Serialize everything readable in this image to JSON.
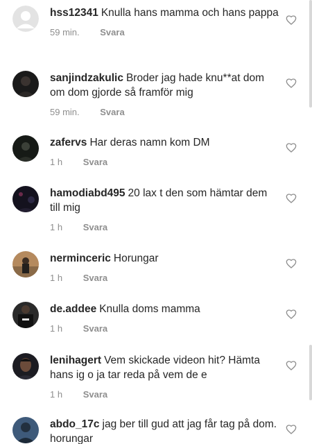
{
  "comments": [
    {
      "username": "hss12341",
      "text": "Knulla hans mamma och hans pappa",
      "time": "59 min.",
      "reply": "Svara",
      "avatar": "default-avatar"
    },
    {
      "username": "sanjindzakulic",
      "text": "Broder jag hade knu**at dom om dom gjorde så framför mig",
      "time": "59 min.",
      "reply": "Svara",
      "avatar": "dark-photo"
    },
    {
      "username": "zafervs",
      "text": "Har deras namn kom DM",
      "time": "1 h",
      "reply": "Svara",
      "avatar": "dark-photo"
    },
    {
      "username": "hamodiabd495",
      "text": "20 lax t den som hämtar dem till mig",
      "time": "1 h",
      "reply": "Svara",
      "avatar": "night-photo"
    },
    {
      "username": "nermin​ceric",
      "text": "Horungar",
      "time": "1 h",
      "reply": "Svara",
      "avatar": "outdoor-photo"
    },
    {
      "username": "de.addee",
      "text": "Knulla doms mamma",
      "time": "1 h",
      "reply": "Svara",
      "avatar": "shirt-photo"
    },
    {
      "username": "lenihagert",
      "text": "Vem skickade videon hit? Hämta hans ig o ja tar reda på vem de e",
      "time": "1 h",
      "reply": "Svara",
      "avatar": "face-photo"
    },
    {
      "username": "abdo_17c",
      "text": "jag ber till gud att jag får tag på dom.  horungar",
      "time": "",
      "reply": "",
      "avatar": "blue-photo"
    }
  ],
  "icons": {
    "like": "heart-outline-icon"
  }
}
